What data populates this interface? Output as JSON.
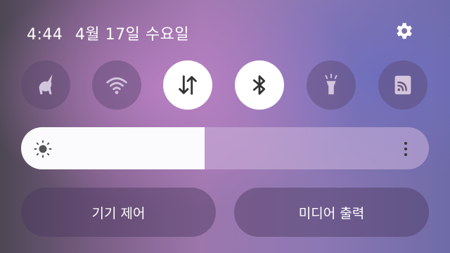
{
  "status": {
    "time": "4:44",
    "date": "4월 17일 수요일"
  },
  "settings": {
    "icon": "gear-icon"
  },
  "quick_tiles": [
    {
      "id": "tile-unicorn",
      "icon": "unicorn-icon",
      "state": "off"
    },
    {
      "id": "tile-wifi",
      "icon": "wifi-icon",
      "state": "off"
    },
    {
      "id": "tile-mobile-data",
      "icon": "mobile-data-icon",
      "state": "on"
    },
    {
      "id": "tile-bluetooth",
      "icon": "bluetooth-icon",
      "state": "on"
    },
    {
      "id": "tile-flashlight",
      "icon": "flashlight-icon",
      "state": "off"
    },
    {
      "id": "tile-cast",
      "icon": "cast-icon",
      "state": "off"
    }
  ],
  "brightness": {
    "level": 0.45,
    "icon": "sun-icon",
    "more_icon": "more-vertical-icon"
  },
  "controls": {
    "device_control_label": "기기 제어",
    "media_output_label": "미디어 출력"
  },
  "colors": {
    "tile_on": "#ffffff",
    "tile_off": "#5a466e",
    "icon_on": "#333333",
    "icon_off": "#d3c5dc"
  }
}
